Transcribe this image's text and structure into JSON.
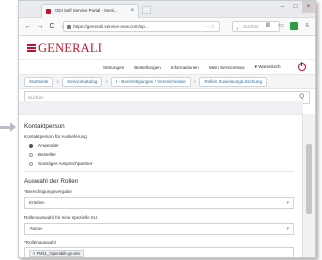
{
  "browser": {
    "tab_title": "GDI Self Service Portal - Servi...",
    "tab_close": "×",
    "new_tab": "+",
    "window_controls": {
      "minimize": "–",
      "maximize": "□",
      "close": "×"
    },
    "back": "←",
    "forward": "→",
    "reload": "C",
    "home": "⌂",
    "url": "https://generali.service-now.com/sp...",
    "url_more": "··· ☆",
    "search_placeholder": "Suchen",
    "toolbar_icons": [
      "Ⅲ",
      "▭",
      "",
      "≡"
    ]
  },
  "header": {
    "logo_text": "GENERALI",
    "nav": [
      "Störungen",
      "Bestellungen",
      "Informationen",
      "Mein ServiceNow",
      "Warenkorb"
    ],
    "cart_icon": "cart-icon"
  },
  "breadcrumb": {
    "items": [
      "Startseite",
      "Servicekatalog",
      "I - Berechtigungen / Verzeichnisse",
      "Rollen Zuweisung/Löschung"
    ],
    "separator": ">"
  },
  "search": {
    "placeholder": "Suchen",
    "icon": "Q"
  },
  "form": {
    "section_contact": "Kontaktperson",
    "contact_label": "Kontaktperson für Auslieferung",
    "radio_options": [
      "Anwender",
      "Besteller",
      "Sonstiger Ansprechpartner"
    ],
    "radio_selected": 0,
    "section_roles": "Auswahl der Rollen",
    "permission_label": "Berechtigungsvergabe",
    "permission_value": "Erteilen",
    "ku_label": "Rollenauswahl für eine spezielle KU",
    "ku_value": "-None-",
    "role_label": "Rollenauswahl",
    "role_tag": "× FM11_Operabili-gs-den",
    "required_mark": "*"
  },
  "colors": {
    "brand_red": "#c8102e",
    "link_blue": "#2b6ea6"
  }
}
